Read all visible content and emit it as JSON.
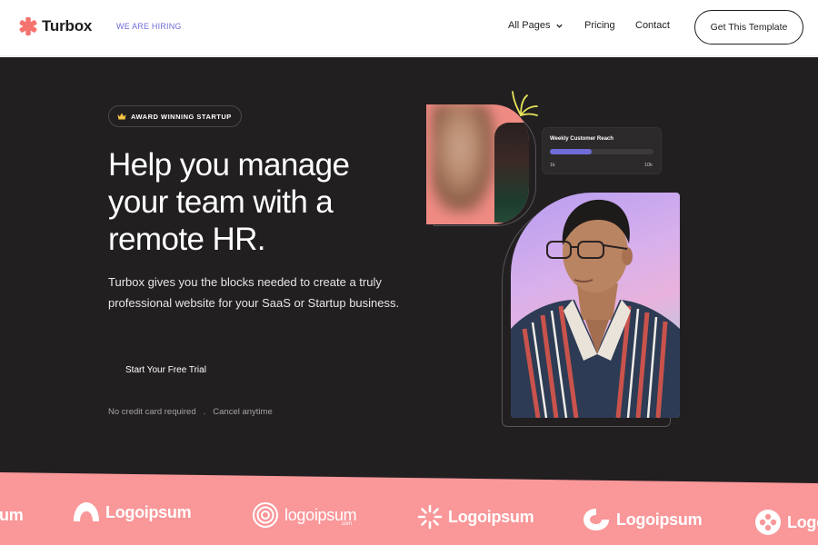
{
  "nav": {
    "brand": "Turbox",
    "hiring": "WE ARE HIRING",
    "all_pages": "All Pages",
    "pricing": "Pricing",
    "contact": "Contact",
    "cta": "Get This Template",
    "brand_color": "#f5736f",
    "accent_color": "#6f6cd8"
  },
  "hero": {
    "badge": "AWARD WINNING STARTUP",
    "headline": "Help you manage your team with a remote HR.",
    "subtext": "Turbox gives you the blocks needed to create a truly professional website for your SaaS or Startup business.",
    "trial_button": "Start Your Free Trial",
    "fine_print_1": "No credit card required",
    "fine_print_sep": ".",
    "fine_print_2": "Cancel anytime",
    "background": "#221f21"
  },
  "reach_card": {
    "title": "Weekly Customer Reach",
    "min": "1k",
    "max": "10k",
    "progress_fraction": 0.4
  },
  "logos": {
    "items": [
      "um",
      "Logoipsum",
      "logoipsum",
      "Logoipsum",
      "Logoipsum",
      "Logo"
    ],
    "sub": ".com",
    "background": "#f99799"
  }
}
